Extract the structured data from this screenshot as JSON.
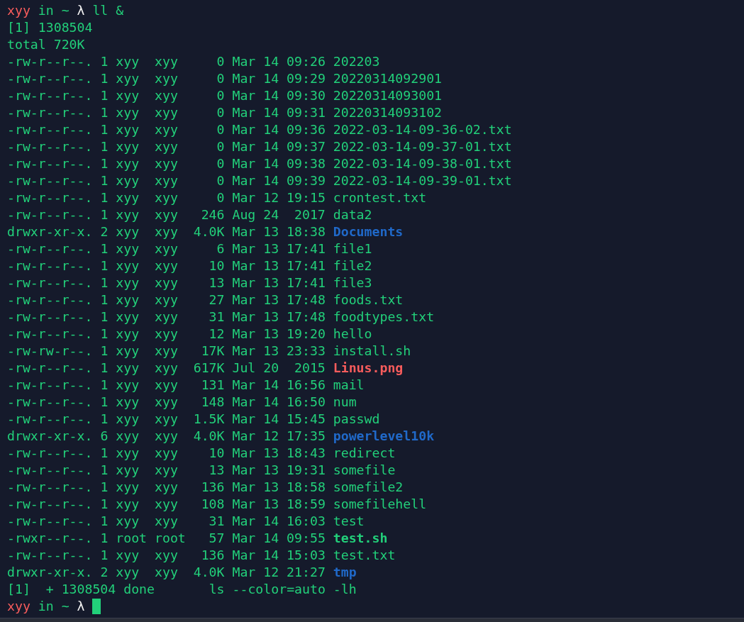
{
  "lines": [
    {
      "kind": "prompt",
      "user": "xyy",
      "connector": "in",
      "dir": "~",
      "symbol": "λ",
      "command": "ll &",
      "cursor": false
    },
    {
      "kind": "output",
      "text": "[1] 1308504"
    },
    {
      "kind": "output",
      "text": "total 720K"
    },
    {
      "kind": "file",
      "perms": "-rw-r--r--.",
      "links": "1",
      "owner": "xyy",
      "group": "xyy",
      "file_size": "0",
      "date": "Mar 14",
      "time": "09:26",
      "name": "202203"
    },
    {
      "kind": "file",
      "perms": "-rw-r--r--.",
      "links": "1",
      "owner": "xyy",
      "group": "xyy",
      "file_size": "0",
      "date": "Mar 14",
      "time": "09:29",
      "name": "20220314092901"
    },
    {
      "kind": "file",
      "perms": "-rw-r--r--.",
      "links": "1",
      "owner": "xyy",
      "group": "xyy",
      "file_size": "0",
      "date": "Mar 14",
      "time": "09:30",
      "name": "20220314093001"
    },
    {
      "kind": "file",
      "perms": "-rw-r--r--.",
      "links": "1",
      "owner": "xyy",
      "group": "xyy",
      "file_size": "0",
      "date": "Mar 14",
      "time": "09:31",
      "name": "20220314093102"
    },
    {
      "kind": "file",
      "perms": "-rw-r--r--.",
      "links": "1",
      "owner": "xyy",
      "group": "xyy",
      "file_size": "0",
      "date": "Mar 14",
      "time": "09:36",
      "name": "2022-03-14-09-36-02.txt"
    },
    {
      "kind": "file",
      "perms": "-rw-r--r--.",
      "links": "1",
      "owner": "xyy",
      "group": "xyy",
      "file_size": "0",
      "date": "Mar 14",
      "time": "09:37",
      "name": "2022-03-14-09-37-01.txt"
    },
    {
      "kind": "file",
      "perms": "-rw-r--r--.",
      "links": "1",
      "owner": "xyy",
      "group": "xyy",
      "file_size": "0",
      "date": "Mar 14",
      "time": "09:38",
      "name": "2022-03-14-09-38-01.txt"
    },
    {
      "kind": "file",
      "perms": "-rw-r--r--.",
      "links": "1",
      "owner": "xyy",
      "group": "xyy",
      "file_size": "0",
      "date": "Mar 14",
      "time": "09:39",
      "name": "2022-03-14-09-39-01.txt"
    },
    {
      "kind": "file",
      "perms": "-rw-r--r--.",
      "links": "1",
      "owner": "xyy",
      "group": "xyy",
      "file_size": "0",
      "date": "Mar 12",
      "time": "19:15",
      "name": "crontest.txt"
    },
    {
      "kind": "file",
      "perms": "-rw-r--r--.",
      "links": "1",
      "owner": "xyy",
      "group": "xyy",
      "file_size": "246",
      "date": "Aug 24",
      "time": "2017",
      "name": "data2"
    },
    {
      "kind": "dir",
      "perms": "drwxr-xr-x.",
      "links": "2",
      "owner": "xyy",
      "group": "xyy",
      "file_size": "4.0K",
      "date": "Mar 13",
      "time": "18:38",
      "name": "Documents"
    },
    {
      "kind": "file",
      "perms": "-rw-r--r--.",
      "links": "1",
      "owner": "xyy",
      "group": "xyy",
      "file_size": "6",
      "date": "Mar 13",
      "time": "17:41",
      "name": "file1"
    },
    {
      "kind": "file",
      "perms": "-rw-r--r--.",
      "links": "1",
      "owner": "xyy",
      "group": "xyy",
      "file_size": "10",
      "date": "Mar 13",
      "time": "17:41",
      "name": "file2"
    },
    {
      "kind": "file",
      "perms": "-rw-r--r--.",
      "links": "1",
      "owner": "xyy",
      "group": "xyy",
      "file_size": "13",
      "date": "Mar 13",
      "time": "17:41",
      "name": "file3"
    },
    {
      "kind": "file",
      "perms": "-rw-r--r--.",
      "links": "1",
      "owner": "xyy",
      "group": "xyy",
      "file_size": "27",
      "date": "Mar 13",
      "time": "17:48",
      "name": "foods.txt"
    },
    {
      "kind": "file",
      "perms": "-rw-r--r--.",
      "links": "1",
      "owner": "xyy",
      "group": "xyy",
      "file_size": "31",
      "date": "Mar 13",
      "time": "17:48",
      "name": "foodtypes.txt"
    },
    {
      "kind": "file",
      "perms": "-rw-r--r--.",
      "links": "1",
      "owner": "xyy",
      "group": "xyy",
      "file_size": "12",
      "date": "Mar 13",
      "time": "19:20",
      "name": "hello"
    },
    {
      "kind": "file",
      "perms": "-rw-rw-r--.",
      "links": "1",
      "owner": "xyy",
      "group": "xyy",
      "file_size": "17K",
      "date": "Mar 13",
      "time": "23:33",
      "name": "install.sh"
    },
    {
      "kind": "image",
      "perms": "-rw-r--r--.",
      "links": "1",
      "owner": "xyy",
      "group": "xyy",
      "file_size": "617K",
      "date": "Jul 20",
      "time": "2015",
      "name": "Linus.png"
    },
    {
      "kind": "file",
      "perms": "-rw-r--r--.",
      "links": "1",
      "owner": "xyy",
      "group": "xyy",
      "file_size": "131",
      "date": "Mar 14",
      "time": "16:56",
      "name": "mail"
    },
    {
      "kind": "file",
      "perms": "-rw-r--r--.",
      "links": "1",
      "owner": "xyy",
      "group": "xyy",
      "file_size": "148",
      "date": "Mar 14",
      "time": "16:50",
      "name": "num"
    },
    {
      "kind": "file",
      "perms": "-rw-r--r--.",
      "links": "1",
      "owner": "xyy",
      "group": "xyy",
      "file_size": "1.5K",
      "date": "Mar 14",
      "time": "15:45",
      "name": "passwd"
    },
    {
      "kind": "dir",
      "perms": "drwxr-xr-x.",
      "links": "6",
      "owner": "xyy",
      "group": "xyy",
      "file_size": "4.0K",
      "date": "Mar 12",
      "time": "17:35",
      "name": "powerlevel10k"
    },
    {
      "kind": "file",
      "perms": "-rw-r--r--.",
      "links": "1",
      "owner": "xyy",
      "group": "xyy",
      "file_size": "10",
      "date": "Mar 13",
      "time": "18:43",
      "name": "redirect"
    },
    {
      "kind": "file",
      "perms": "-rw-r--r--.",
      "links": "1",
      "owner": "xyy",
      "group": "xyy",
      "file_size": "13",
      "date": "Mar 13",
      "time": "19:31",
      "name": "somefile"
    },
    {
      "kind": "file",
      "perms": "-rw-r--r--.",
      "links": "1",
      "owner": "xyy",
      "group": "xyy",
      "file_size": "136",
      "date": "Mar 13",
      "time": "18:58",
      "name": "somefile2"
    },
    {
      "kind": "file",
      "perms": "-rw-r--r--.",
      "links": "1",
      "owner": "xyy",
      "group": "xyy",
      "file_size": "108",
      "date": "Mar 13",
      "time": "18:59",
      "name": "somefilehell"
    },
    {
      "kind": "file",
      "perms": "-rw-r--r--.",
      "links": "1",
      "owner": "xyy",
      "group": "xyy",
      "file_size": "31",
      "date": "Mar 14",
      "time": "16:03",
      "name": "test"
    },
    {
      "kind": "exec",
      "perms": "-rwxr--r--.",
      "links": "1",
      "owner": "root",
      "group": "root",
      "file_size": "57",
      "date": "Mar 14",
      "time": "09:55",
      "name": "test.sh"
    },
    {
      "kind": "file",
      "perms": "-rw-r--r--.",
      "links": "1",
      "owner": "xyy",
      "group": "xyy",
      "file_size": "136",
      "date": "Mar 14",
      "time": "15:03",
      "name": "test.txt"
    },
    {
      "kind": "dir",
      "perms": "drwxr-xr-x.",
      "links": "2",
      "owner": "xyy",
      "group": "xyy",
      "file_size": "4.0K",
      "date": "Mar 12",
      "time": "21:27",
      "name": "tmp"
    },
    {
      "kind": "job",
      "job": "[1]",
      "sign": "+",
      "pid": "1308504",
      "status": "done",
      "command": "ls --color=auto -lh"
    },
    {
      "kind": "prompt",
      "user": "xyy",
      "connector": "in",
      "dir": "~",
      "symbol": "λ",
      "cursor": true
    }
  ]
}
